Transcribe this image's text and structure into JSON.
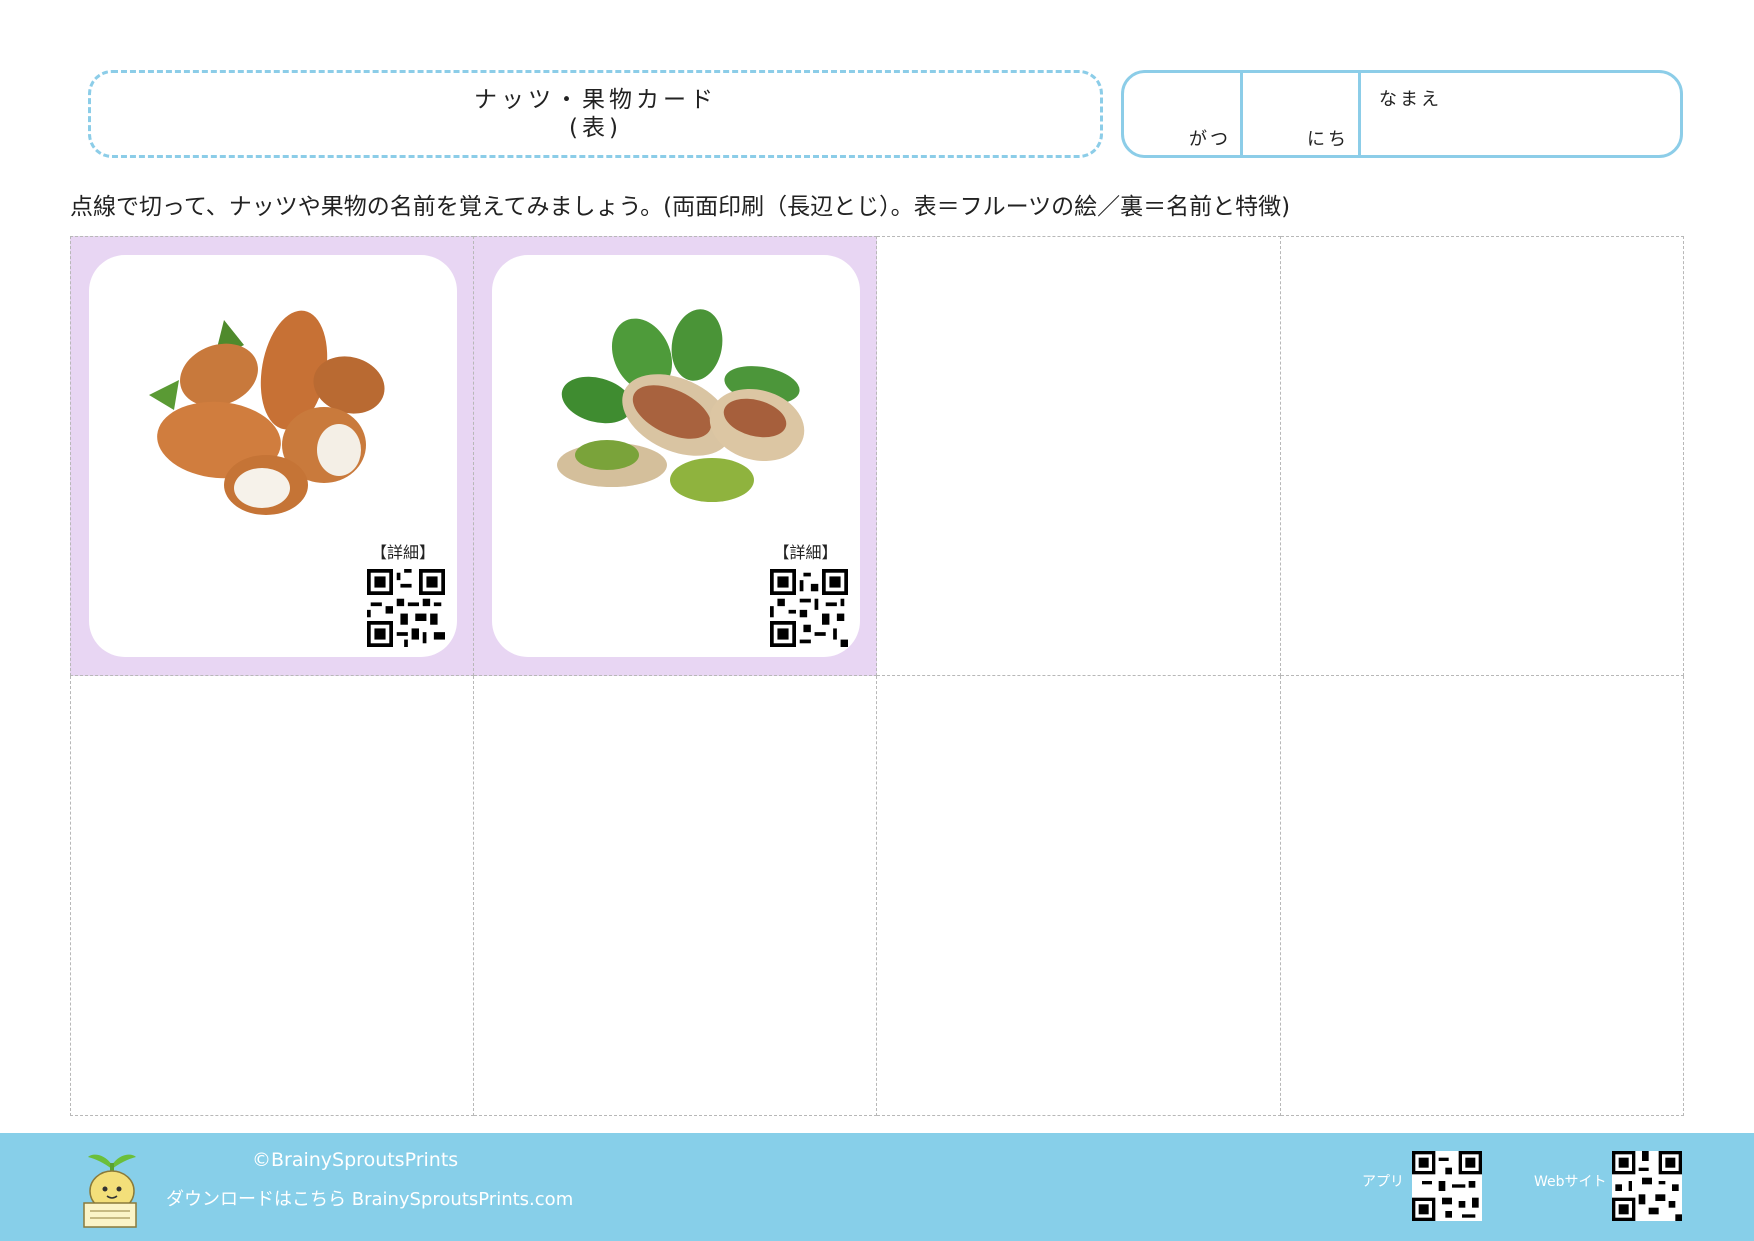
{
  "header": {
    "title_line1": "ナッツ・果物カード",
    "title_line2": "(表)",
    "month_label": "がつ",
    "day_label": "にち",
    "name_label": "なまえ"
  },
  "instructions": "点線で切って、ナッツや果物の名前を覚えてみましょう。(両面印刷（長辺とじ）。表＝フルーツの絵／裏＝名前と特徴)",
  "cards": [
    {
      "image": "almonds",
      "detail_label": "【詳細】",
      "icon": "qr-code-icon"
    },
    {
      "image": "pistachios",
      "detail_label": "【詳細】",
      "icon": "qr-code-icon"
    }
  ],
  "colors": {
    "accent": "#8ccde8",
    "card_background": "#e8d6f3",
    "footer": "#87cfe9"
  },
  "footer": {
    "copyright": "©BrainySproutsPrints",
    "download": "ダウンロードはこちら BrainySproutsPrints.com",
    "app_label": "アプリ",
    "web_label": "Webサイト"
  }
}
